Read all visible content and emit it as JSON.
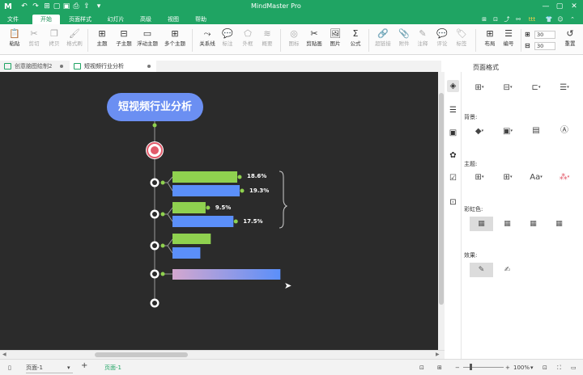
{
  "app": {
    "title": "MindMaster Pro",
    "logo": "M"
  },
  "menu": [
    "文件",
    "开始",
    "页面样式",
    "幻灯片",
    "高级",
    "视图",
    "帮助"
  ],
  "ribbon": [
    {
      "icon": "📋",
      "label": "粘贴"
    },
    {
      "icon": "✂",
      "label": "剪切"
    },
    {
      "icon": "❐",
      "label": "拷贝"
    },
    {
      "icon": "🖌",
      "label": "格式刷"
    },
    {
      "icon": "⊞",
      "label": "主题"
    },
    {
      "icon": "⊟",
      "label": "子主题"
    },
    {
      "icon": "▭",
      "label": "浮动主题"
    },
    {
      "icon": "⊞",
      "label": "多个主题"
    },
    {
      "icon": "⤳",
      "label": "关系线"
    },
    {
      "icon": "💬",
      "label": "标注"
    },
    {
      "icon": "⬠",
      "label": "外框"
    },
    {
      "icon": "≋",
      "label": "概要"
    },
    {
      "icon": "◎",
      "label": "图标"
    },
    {
      "icon": "✂",
      "label": "剪贴画"
    },
    {
      "icon": "🖼",
      "label": "图片"
    },
    {
      "icon": "Σ",
      "label": "公式"
    },
    {
      "icon": "🔗",
      "label": "超链接"
    },
    {
      "icon": "📎",
      "label": "附件"
    },
    {
      "icon": "✎",
      "label": "注释"
    },
    {
      "icon": "💬",
      "label": "评论"
    },
    {
      "icon": "🏷",
      "label": "标签"
    },
    {
      "icon": "⊞",
      "label": "布局"
    },
    {
      "icon": "☰",
      "label": "编号"
    },
    {
      "icon": "↺",
      "label": "重置"
    }
  ],
  "spinners": [
    "30",
    "30"
  ],
  "tabs": [
    {
      "label": "创意脑图绘制2"
    },
    {
      "label": "短视频行业分析"
    }
  ],
  "mindmap": {
    "root": "短视频行业分析",
    "colors": {
      "root": "#6b8ff2",
      "green": "#8fd14f",
      "blue": "#5b8ff9",
      "gradient_start": "#d4a7cf",
      "gradient_end": "#5b8ff9",
      "red_ring": "#e25a6a"
    }
  },
  "chart_data": {
    "type": "bar",
    "orientation": "horizontal",
    "series": [
      {
        "values": [
          18.6,
          9.5,
          null,
          null
        ],
        "labels": [
          "18.6%",
          "9.5%",
          "",
          ""
        ]
      },
      {
        "values": [
          19.3,
          17.5,
          null,
          null
        ],
        "labels": [
          "19.3%",
          "17.5%",
          "",
          ""
        ]
      }
    ],
    "unlabeled_relative_lengths": [
      {
        "group": 3,
        "row": 1,
        "value": 11.0
      },
      {
        "group": 3,
        "row": 2,
        "value": 8.0
      },
      {
        "group": 4,
        "row": 1,
        "value": 31.0
      }
    ]
  },
  "panel": {
    "title": "页面格式",
    "background_label": "背景:",
    "theme_label": "主题:",
    "rainbow_label": "彩虹色:",
    "effect_label": "效果:"
  },
  "status": {
    "page_select": "页面-1",
    "page_tab": "页面-1",
    "zoom": "100%"
  }
}
